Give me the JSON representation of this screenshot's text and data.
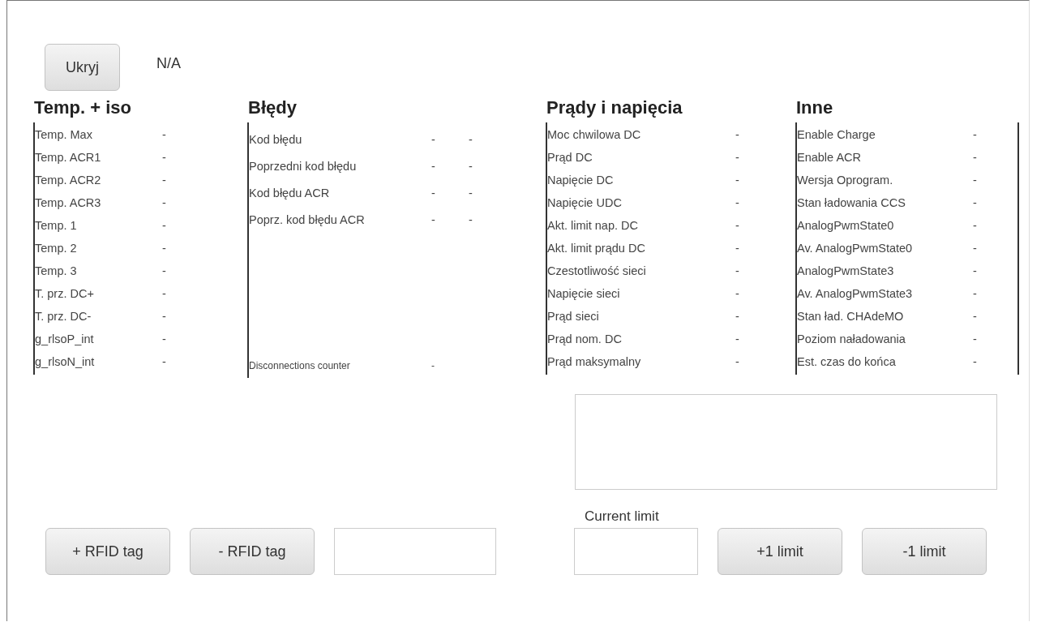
{
  "hide_button": "Ukryj",
  "status": "N/A",
  "sections": [
    {
      "title": "Temp. + iso",
      "kind": "compact",
      "rows": [
        {
          "label": "Temp. Max",
          "values": [
            "-"
          ]
        },
        {
          "label": "Temp. ACR1",
          "values": [
            "-"
          ]
        },
        {
          "label": "Temp. ACR2",
          "values": [
            "-"
          ]
        },
        {
          "label": "Temp. ACR3",
          "values": [
            "-"
          ]
        },
        {
          "label": "Temp.  1",
          "values": [
            "-"
          ]
        },
        {
          "label": "Temp.  2",
          "values": [
            "-"
          ]
        },
        {
          "label": "Temp.  3",
          "values": [
            "-"
          ]
        },
        {
          "label": "T. prz. DC+",
          "values": [
            "-"
          ]
        },
        {
          "label": "T. prz. DC-",
          "values": [
            "-"
          ]
        },
        {
          "label": "g_rlsoP_int",
          "values": [
            "-"
          ]
        },
        {
          "label": "g_rlsoN_int",
          "values": [
            "-"
          ]
        }
      ]
    },
    {
      "title": "Błędy",
      "kind": "spaced",
      "rows": [
        {
          "label": "Kod błędu",
          "values": [
            "-",
            "-"
          ]
        },
        {
          "label": "Poprzedni kod błędu",
          "values": [
            "-",
            "-"
          ]
        },
        {
          "label": "Kod błędu ACR",
          "values": [
            "-",
            "-"
          ]
        },
        {
          "label": "Poprz. kod błędu ACR",
          "values": [
            "-",
            "-"
          ]
        }
      ],
      "footer": {
        "label": "Disconnections counter",
        "values": [
          "-"
        ]
      }
    },
    {
      "title": "Prądy i napięcia",
      "kind": "compact",
      "rows": [
        {
          "label": "Moc chwilowa DC",
          "values": [
            "-"
          ]
        },
        {
          "label": "Prąd DC",
          "values": [
            "-"
          ]
        },
        {
          "label": "Napięcie DC",
          "values": [
            "-"
          ]
        },
        {
          "label": "Napięcie UDC",
          "values": [
            "-"
          ]
        },
        {
          "label": "Akt. limit nap. DC",
          "values": [
            "-"
          ]
        },
        {
          "label": "Akt. limit prądu DC",
          "values": [
            "-"
          ]
        },
        {
          "label": "Czestotliwość sieci",
          "values": [
            "-"
          ]
        },
        {
          "label": "Napięcie sieci",
          "values": [
            "-"
          ]
        },
        {
          "label": "Prąd sieci",
          "values": [
            "-"
          ]
        },
        {
          "label": "Prąd nom. DC",
          "values": [
            "-"
          ]
        },
        {
          "label": "Prąd maksymalny",
          "values": [
            "-"
          ]
        }
      ]
    },
    {
      "title": "Inne",
      "kind": "compact",
      "rows": [
        {
          "label": "Enable Charge",
          "values": [
            "-"
          ]
        },
        {
          "label": "Enable ACR",
          "values": [
            "-"
          ]
        },
        {
          "label": "Wersja Oprogram.",
          "values": [
            "-"
          ]
        },
        {
          "label": "Stan ładowania CCS",
          "values": [
            "-"
          ]
        },
        {
          "label": "AnalogPwmState0",
          "values": [
            "-"
          ]
        },
        {
          "label": "Av. AnalogPwmState0",
          "values": [
            "-"
          ]
        },
        {
          "label": "AnalogPwmState3",
          "values": [
            "-"
          ]
        },
        {
          "label": "Av. AnalogPwmState3",
          "values": [
            "-"
          ]
        },
        {
          "label": "Stan ład. CHAdeMO",
          "values": [
            "-"
          ]
        },
        {
          "label": "Poziom naładowania",
          "values": [
            "-"
          ]
        },
        {
          "label": "Est. czas do końca",
          "values": [
            "-"
          ]
        }
      ]
    }
  ],
  "rfid_buttons": [
    "+ RFID tag",
    "- RFID tag"
  ],
  "current_limit_label": "Current limit",
  "limit_buttons": [
    "+1 limit",
    "-1 limit"
  ]
}
